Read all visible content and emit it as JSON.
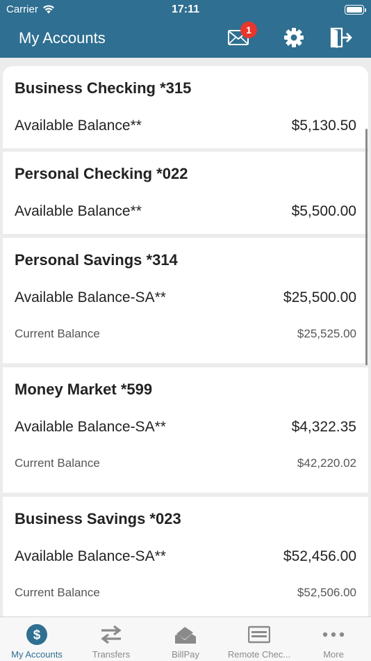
{
  "status_bar": {
    "carrier": "Carrier",
    "time": "17:11"
  },
  "header": {
    "title": "My Accounts",
    "mail_badge": "1"
  },
  "accounts": [
    {
      "name": "Business Checking *315",
      "available_label": "Available Balance**",
      "available_value": "$5,130.50"
    },
    {
      "name": "Personal Checking *022",
      "available_label": "Available Balance**",
      "available_value": "$5,500.00"
    },
    {
      "name": "Personal Savings *314",
      "available_label": "Available Balance-SA**",
      "available_value": "$25,500.00",
      "current_label": "Current Balance",
      "current_value": "$25,525.00"
    },
    {
      "name": "Money Market *599",
      "available_label": "Available Balance-SA**",
      "available_value": "$4,322.35",
      "current_label": "Current Balance",
      "current_value": "$42,220.02"
    },
    {
      "name": "Business Savings *023",
      "available_label": "Available Balance-SA**",
      "available_value": "$52,456.00",
      "current_label": "Current Balance",
      "current_value": "$52,506.00"
    }
  ],
  "tabs": [
    {
      "label": "My Accounts",
      "icon": "dollar-icon",
      "active": true
    },
    {
      "label": "Transfers",
      "icon": "transfer-arrows-icon"
    },
    {
      "label": "BillPay",
      "icon": "billpay-icon"
    },
    {
      "label": "Remote Chec...",
      "icon": "check-card-icon"
    },
    {
      "label": "More",
      "icon": "more-dots-icon"
    }
  ],
  "colors": {
    "header": "#2f6f91",
    "badge": "#e8362e",
    "tab_active": "#2f6f91",
    "tab_inactive": "#8a8a8a"
  }
}
